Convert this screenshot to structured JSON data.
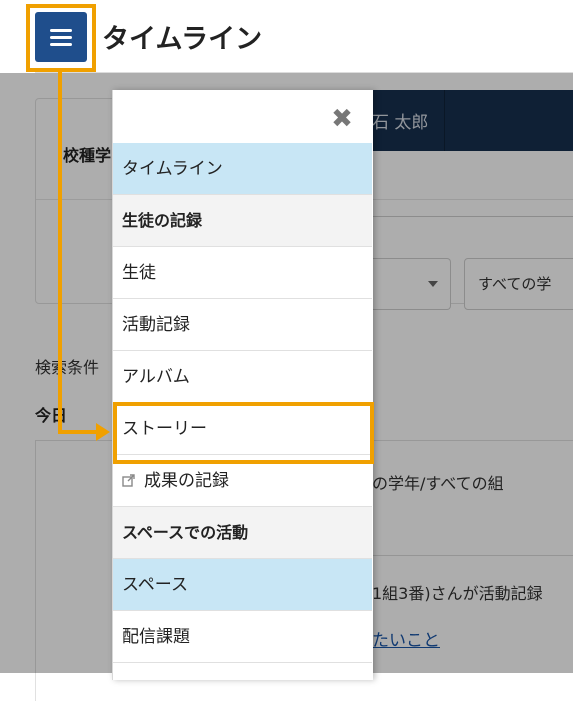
{
  "header": {
    "title": "タイムライン",
    "menu_icon": "hamburger-icon"
  },
  "background": {
    "user_name": "石 太郎",
    "field_label": "校種学",
    "select_b_value": "すべての学",
    "search_conditions": "検索条件",
    "today": "今日",
    "filter_text": "の学年/すべての組",
    "activity_text": "1組3番)さんが活動記録",
    "activity_link": "たいこと"
  },
  "drawer": {
    "close_icon": "close-icon",
    "items": [
      {
        "type": "item",
        "label": "タイムライン",
        "active": true
      },
      {
        "type": "header",
        "label": "生徒の記録"
      },
      {
        "type": "item",
        "label": "生徒",
        "active": false
      },
      {
        "type": "item",
        "label": "活動記録",
        "active": false
      },
      {
        "type": "item",
        "label": "アルバム",
        "active": false
      },
      {
        "type": "item",
        "label": "ストーリー",
        "active": false
      },
      {
        "type": "item",
        "label": "成果の記録",
        "active": false,
        "icon": "external-link-icon"
      },
      {
        "type": "header",
        "label": "スペースでの活動"
      },
      {
        "type": "item",
        "label": "スペース",
        "active": true
      },
      {
        "type": "item",
        "label": "配信課題",
        "active": false
      }
    ]
  },
  "colors": {
    "primary": "#1f4e8c",
    "highlight": "#f0a000",
    "active_item": "#c8e6f5",
    "user_bar": "#17304f"
  }
}
